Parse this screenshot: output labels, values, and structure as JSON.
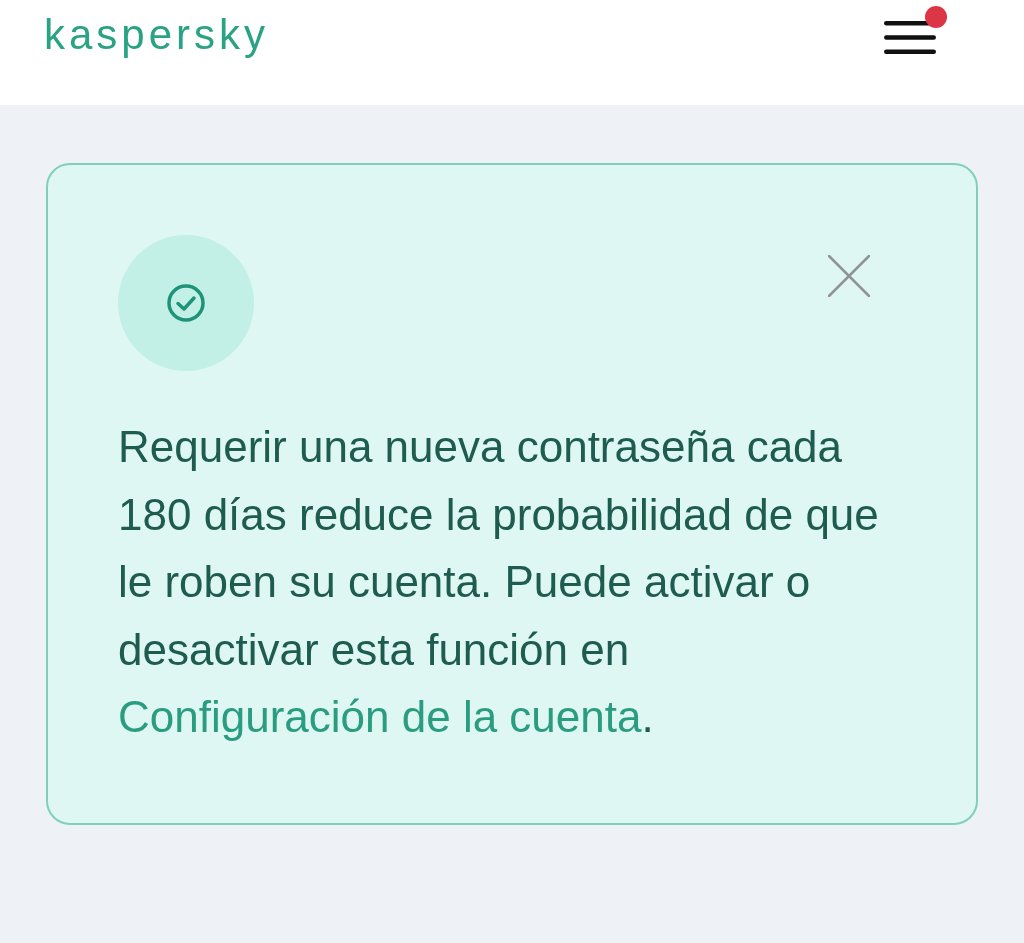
{
  "header": {
    "logo": "kaspersky",
    "menu": {
      "notification": true
    }
  },
  "notice": {
    "kind": "success",
    "closable": true,
    "text": "Requerir una nueva contraseña cada 180 días reduce la probabilidad de que le roben su cuenta. Puede activar o desactivar esta función en",
    "link": "Configuración de la cuenta",
    "after_link": "."
  }
}
